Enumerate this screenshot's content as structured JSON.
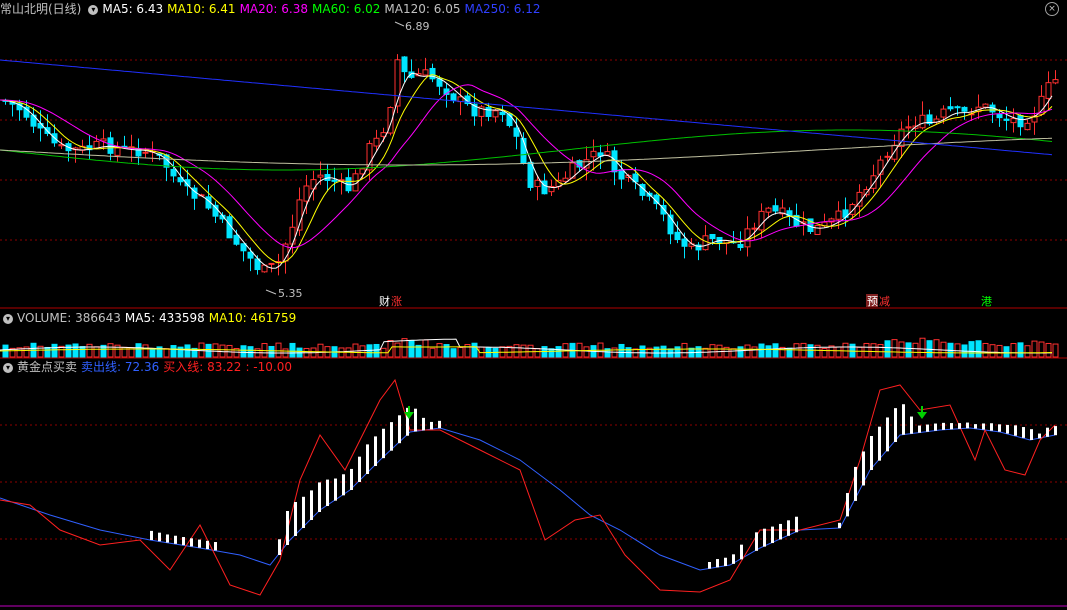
{
  "header": {
    "title": "常山北明(日线)",
    "ma": [
      {
        "label": "MA5: 6.43",
        "color": "#ffffff"
      },
      {
        "label": "MA10: 6.41",
        "color": "#ffff00"
      },
      {
        "label": "MA20: 6.38",
        "color": "#ff00ff"
      },
      {
        "label": "MA60: 6.02",
        "color": "#00ff00"
      },
      {
        "label": "MA120: 6.05",
        "color": "#c0c0c0"
      },
      {
        "label": "MA250: 6.12",
        "color": "#3040ff"
      }
    ]
  },
  "volume_header": {
    "label": "VOLUME: 386643",
    "ma5": "MA5: 433598",
    "ma10": "MA10: 461759"
  },
  "indicator_header": {
    "name": "黄金点买卖",
    "sell": "卖出线: 72.36",
    "buy": "买入线: 83.22",
    "diff": ": -10.00"
  },
  "price_labels": {
    "high": "6.89",
    "low": "5.35"
  },
  "markers": [
    {
      "text": "财",
      "color": "#ffffff",
      "bg": "#000000"
    },
    {
      "text": "涨",
      "color": "#ff3030",
      "bg": "#000000"
    },
    {
      "text": "预",
      "color": "#ffffff",
      "bg": "#802020"
    },
    {
      "text": "减",
      "color": "#ff3030",
      "bg": "#000000"
    },
    {
      "text": "港",
      "color": "#00ff00",
      "bg": "#000000"
    }
  ],
  "colors": {
    "up": "#ff3030",
    "down": "#00e5ff",
    "grid": "#8b0000",
    "sell_line": "#3060ff",
    "buy_line": "#ff2020"
  }
}
